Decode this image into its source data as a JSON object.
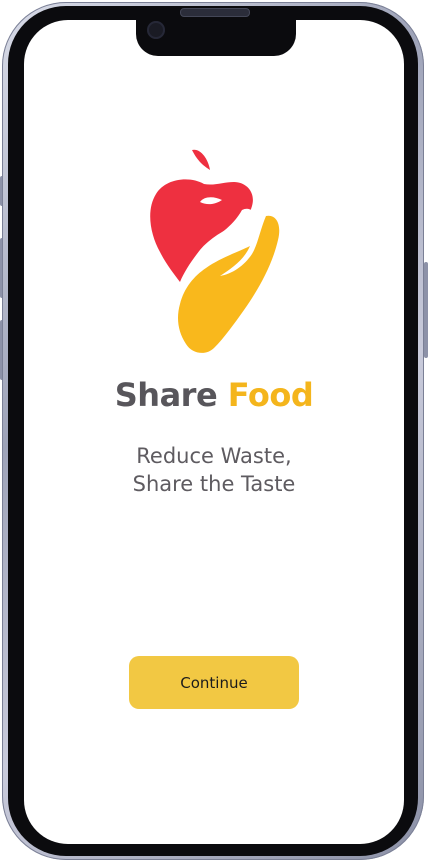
{
  "app": {
    "brand_first": "Share",
    "brand_second": "Food"
  },
  "onboarding": {
    "tagline_line1": "Reduce Waste,",
    "tagline_line2": "Share the Taste",
    "continue_label": "Continue"
  },
  "theme": {
    "accent": "#f2c843",
    "brand_yellow": "#f4b51c",
    "apple_red": "#ee3040",
    "text_gray": "#58565b"
  },
  "icons": {
    "logo": "apple-hand-logo"
  }
}
